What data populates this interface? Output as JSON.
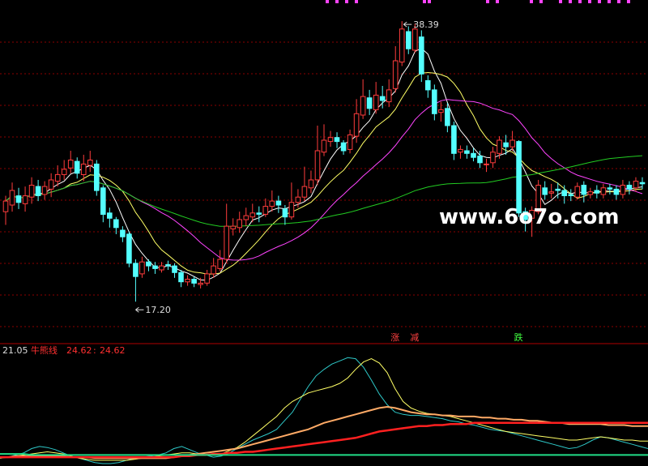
{
  "chart_data": [
    {
      "type": "candlestick",
      "title": "",
      "ylim": [
        15.5,
        39.5
      ],
      "grid": true,
      "watermark": "www.6o7o.com",
      "annotations": {
        "high": {
          "label": "38.39",
          "value": 38.39,
          "index": 61
        },
        "low": {
          "label": "17.20",
          "value": 17.2,
          "index": 20
        }
      },
      "signals": [
        {
          "label": "涨",
          "index": 60,
          "color": "#ff4040"
        },
        {
          "label": "减",
          "index": 63,
          "color": "#ff4040"
        },
        {
          "label": "跌",
          "index": 79,
          "color": "#40ff40"
        }
      ],
      "series": [
        {
          "name": "MA5",
          "color": "#ffffff",
          "kind": "ma",
          "period": 5
        },
        {
          "name": "MA10",
          "color": "#ffff66",
          "kind": "ma",
          "period": 10
        },
        {
          "name": "MA20",
          "color": "#ff44ff",
          "kind": "ma",
          "period": 20
        },
        {
          "name": "MA60",
          "color": "#22cc22",
          "kind": "ma",
          "period": 60
        }
      ],
      "candles": [
        [
          24.0,
          24.8,
          23.0,
          25.2
        ],
        [
          24.5,
          25.6,
          24.0,
          26.2
        ],
        [
          25.2,
          24.7,
          24.2,
          25.8
        ],
        [
          24.6,
          25.2,
          24.0,
          25.9
        ],
        [
          25.1,
          26.0,
          24.6,
          26.6
        ],
        [
          25.9,
          25.2,
          24.8,
          26.4
        ],
        [
          25.3,
          25.9,
          24.9,
          26.3
        ],
        [
          25.7,
          26.4,
          25.1,
          26.9
        ],
        [
          26.3,
          26.8,
          25.9,
          27.5
        ],
        [
          26.8,
          27.2,
          26.4,
          27.9
        ],
        [
          27.3,
          27.9,
          26.9,
          28.6
        ],
        [
          27.8,
          26.9,
          26.5,
          28.1
        ],
        [
          26.8,
          27.6,
          26.3,
          28.3
        ],
        [
          27.5,
          27.9,
          27.0,
          28.6
        ],
        [
          27.6,
          25.6,
          25.2,
          27.9
        ],
        [
          25.8,
          23.8,
          23.2,
          26.0
        ],
        [
          23.9,
          23.5,
          22.8,
          24.3
        ],
        [
          23.4,
          22.8,
          22.3,
          23.6
        ],
        [
          22.6,
          22.1,
          21.7,
          22.9
        ],
        [
          22.3,
          20.1,
          19.8,
          22.5
        ],
        [
          20.1,
          19.1,
          17.2,
          20.4
        ],
        [
          19.3,
          20.2,
          19.0,
          20.6
        ],
        [
          20.2,
          19.9,
          19.5,
          20.4
        ],
        [
          19.9,
          19.7,
          19.3,
          20.2
        ],
        [
          19.6,
          19.9,
          19.4,
          20.2
        ],
        [
          20.0,
          19.9,
          19.6,
          20.3
        ],
        [
          19.9,
          19.4,
          19.0,
          20.1
        ],
        [
          19.4,
          18.7,
          18.3,
          19.6
        ],
        [
          18.7,
          18.9,
          18.4,
          19.2
        ],
        [
          18.9,
          18.6,
          18.3,
          19.1
        ],
        [
          18.5,
          18.6,
          18.2,
          19.0
        ],
        [
          18.6,
          19.3,
          18.4,
          19.6
        ],
        [
          19.3,
          19.9,
          19.0,
          20.5
        ],
        [
          19.7,
          20.4,
          19.5,
          21.1
        ],
        [
          20.4,
          22.9,
          20.1,
          24.6
        ],
        [
          22.7,
          22.9,
          22.2,
          23.5
        ],
        [
          22.8,
          23.4,
          22.4,
          24.0
        ],
        [
          23.4,
          23.7,
          22.9,
          24.3
        ],
        [
          23.6,
          23.9,
          23.2,
          24.6
        ],
        [
          23.9,
          23.8,
          23.2,
          24.4
        ],
        [
          23.8,
          24.4,
          23.6,
          25.0
        ],
        [
          24.4,
          24.8,
          24.0,
          25.6
        ],
        [
          24.8,
          24.5,
          23.9,
          25.2
        ],
        [
          24.2,
          23.6,
          23.0,
          24.5
        ],
        [
          23.6,
          24.7,
          23.4,
          26.2
        ],
        [
          24.7,
          25.1,
          24.3,
          25.7
        ],
        [
          25.1,
          25.9,
          24.8,
          27.4
        ],
        [
          25.8,
          26.4,
          25.4,
          27.1
        ],
        [
          26.4,
          28.6,
          26.0,
          30.5
        ],
        [
          28.5,
          29.4,
          28.2,
          30.6
        ],
        [
          29.3,
          29.6,
          28.9,
          30.1
        ],
        [
          29.6,
          29.3,
          28.8,
          30.0
        ],
        [
          29.2,
          28.6,
          28.3,
          29.4
        ],
        [
          28.7,
          29.8,
          28.4,
          30.2
        ],
        [
          29.7,
          31.4,
          29.2,
          32.5
        ],
        [
          31.3,
          32.7,
          31.0,
          34.0
        ],
        [
          32.6,
          31.8,
          31.3,
          33.2
        ],
        [
          31.7,
          32.8,
          31.4,
          33.8
        ],
        [
          32.7,
          32.4,
          31.8,
          33.5
        ],
        [
          32.3,
          33.2,
          31.9,
          34.0
        ],
        [
          33.3,
          35.4,
          33.0,
          36.5
        ],
        [
          35.3,
          37.8,
          35.0,
          38.39
        ],
        [
          37.6,
          36.3,
          35.9,
          38.0
        ],
        [
          36.2,
          37.8,
          36.0,
          38.2
        ],
        [
          37.2,
          34.4,
          33.8,
          37.7
        ],
        [
          33.9,
          33.2,
          32.6,
          34.3
        ],
        [
          33.2,
          31.4,
          30.9,
          33.6
        ],
        [
          31.5,
          31.7,
          30.8,
          32.3
        ],
        [
          31.8,
          30.5,
          30.0,
          32.2
        ],
        [
          30.5,
          28.4,
          27.9,
          30.8
        ],
        [
          28.5,
          28.7,
          28.0,
          29.0
        ],
        [
          28.6,
          28.4,
          28.0,
          29.0
        ],
        [
          28.4,
          28.1,
          27.8,
          28.8
        ],
        [
          28.2,
          27.7,
          27.3,
          28.6
        ],
        [
          27.6,
          27.6,
          27.0,
          28.0
        ],
        [
          27.7,
          28.5,
          27.3,
          28.9
        ],
        [
          28.4,
          29.4,
          28.0,
          29.7
        ],
        [
          29.2,
          28.9,
          28.3,
          29.8
        ],
        [
          28.9,
          29.4,
          28.6,
          30.1
        ],
        [
          29.3,
          23.9,
          23.6,
          29.4
        ],
        [
          24.0,
          23.4,
          22.5,
          24.3
        ],
        [
          23.5,
          24.1,
          22.1,
          24.4
        ],
        [
          24.0,
          26.0,
          23.8,
          26.4
        ],
        [
          25.8,
          25.3,
          24.9,
          26.3
        ],
        [
          25.4,
          25.5,
          25.0,
          26.1
        ],
        [
          25.7,
          25.6,
          25.0,
          26.2
        ],
        [
          25.6,
          25.2,
          24.6,
          26.0
        ],
        [
          25.3,
          25.2,
          24.8,
          25.7
        ],
        [
          25.1,
          25.9,
          24.9,
          26.2
        ],
        [
          26.0,
          25.3,
          24.7,
          26.3
        ],
        [
          25.3,
          25.5,
          25.0,
          25.8
        ],
        [
          25.6,
          25.4,
          25.0,
          26.0
        ],
        [
          25.3,
          25.8,
          25.0,
          26.1
        ],
        [
          25.8,
          25.7,
          25.3,
          26.1
        ],
        [
          25.7,
          25.3,
          24.9,
          26.0
        ],
        [
          25.3,
          26.0,
          25.0,
          26.4
        ],
        [
          26.0,
          25.7,
          25.3,
          26.3
        ],
        [
          25.8,
          26.3,
          25.5,
          26.6
        ],
        [
          26.2,
          26.1,
          25.7,
          26.6
        ]
      ]
    },
    {
      "type": "line",
      "title": "",
      "ylim": [
        0,
        100
      ],
      "header": {
        "value": "21.05",
        "name": "牛熊线",
        "v1": "24.62",
        "sep": ":",
        "v2": "24.62"
      },
      "series": [
        {
          "color": "#2ec8c8",
          "values": [
            5,
            6,
            8,
            10,
            14,
            16,
            15,
            13,
            10,
            7,
            5,
            3,
            1,
            0,
            0,
            1,
            3,
            5,
            6,
            7,
            8,
            10,
            14,
            16,
            13,
            10,
            8,
            6,
            7,
            10,
            14,
            18,
            22,
            25,
            28,
            32,
            40,
            48,
            60,
            72,
            82,
            88,
            93,
            96,
            99,
            98,
            90,
            78,
            65,
            55,
            48,
            46,
            45,
            45,
            44,
            43,
            42,
            40,
            39,
            37,
            36,
            34,
            32,
            31,
            30,
            28,
            26,
            24,
            22,
            20,
            18,
            16,
            14,
            15,
            18,
            22,
            25,
            24,
            22,
            20,
            18,
            16,
            14
          ]
        },
        {
          "color": "#ffff66",
          "values": [
            5,
            6,
            7,
            8,
            9,
            10,
            11,
            10,
            9,
            7,
            5,
            4,
            3,
            3,
            3,
            3,
            3,
            4,
            5,
            6,
            7,
            8,
            9,
            10,
            10,
            9,
            8,
            8,
            9,
            12,
            15,
            20,
            26,
            32,
            38,
            44,
            52,
            58,
            62,
            66,
            68,
            70,
            72,
            75,
            80,
            88,
            95,
            98,
            94,
            85,
            70,
            58,
            52,
            49,
            47,
            46,
            45,
            44,
            42,
            40,
            38,
            36,
            34,
            32,
            30,
            29,
            28,
            27,
            26,
            25,
            24,
            23,
            22,
            22,
            23,
            24,
            25,
            24,
            23,
            22,
            22,
            21,
            21
          ]
        },
        {
          "color": "#ffaa66",
          "values": [
            6,
            6,
            7,
            7,
            7,
            7,
            7,
            7,
            7,
            6,
            6,
            6,
            5,
            5,
            5,
            5,
            5,
            5,
            5,
            5,
            5,
            5,
            6,
            7,
            8,
            9,
            10,
            11,
            12,
            13,
            14,
            16,
            18,
            20,
            22,
            24,
            26,
            28,
            30,
            32,
            35,
            38,
            40,
            42,
            44,
            46,
            48,
            50,
            52,
            53,
            52,
            50,
            48,
            47,
            46,
            46,
            45,
            45,
            44,
            44,
            44,
            43,
            43,
            42,
            42,
            41,
            41,
            40,
            40,
            39,
            38,
            38,
            37,
            37,
            37,
            37,
            37,
            36,
            36,
            36,
            35,
            35,
            35
          ]
        },
        {
          "color": "#ff2020",
          "values": [
            6,
            6,
            6,
            6,
            6,
            6,
            6,
            6,
            6,
            6,
            6,
            6,
            6,
            6,
            6,
            6,
            6,
            6,
            6,
            6,
            6,
            6,
            6,
            7,
            7,
            8,
            8,
            9,
            9,
            10,
            10,
            11,
            11,
            12,
            13,
            14,
            15,
            16,
            17,
            18,
            19,
            20,
            21,
            22,
            23,
            24,
            26,
            28,
            30,
            31,
            32,
            33,
            34,
            35,
            35,
            36,
            36,
            37,
            37,
            37,
            38,
            38,
            38,
            38,
            38,
            38,
            38,
            38,
            38,
            38,
            38,
            38,
            38,
            38,
            38,
            38,
            38,
            38,
            38,
            38,
            38,
            38,
            38
          ]
        },
        {
          "color": "#22dd88",
          "values": [
            9,
            9,
            9,
            9,
            8,
            8,
            8,
            8,
            8,
            8,
            8,
            8,
            8,
            8,
            8,
            8,
            8,
            8,
            8,
            8,
            8,
            8,
            8,
            8,
            8,
            8,
            8,
            8,
            8,
            8,
            8,
            8,
            8,
            8,
            8,
            8,
            8,
            8,
            8,
            8,
            8,
            8,
            8,
            8,
            8,
            8,
            8,
            8,
            8,
            8,
            8,
            8,
            8,
            8,
            8,
            8,
            8,
            8,
            8,
            8,
            8,
            8,
            8,
            8,
            8,
            8,
            8,
            8,
            8,
            8,
            8,
            8,
            8,
            8,
            8,
            8,
            8,
            8,
            8,
            8,
            8,
            8,
            8
          ]
        }
      ]
    }
  ]
}
